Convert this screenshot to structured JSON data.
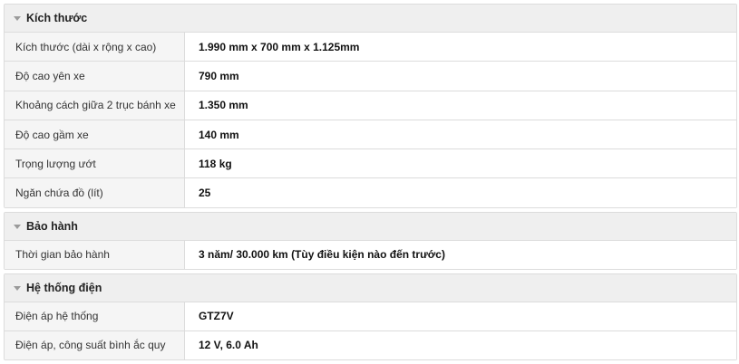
{
  "sections": [
    {
      "title": "Kích thước",
      "rows": [
        {
          "label": "Kích thước (dài x rộng x cao)",
          "value": "1.990 mm x 700 mm x 1.125mm"
        },
        {
          "label": "Độ cao yên xe",
          "value": "790 mm"
        },
        {
          "label": "Khoảng cách giữa 2 trục bánh xe",
          "value": "1.350 mm"
        },
        {
          "label": "Độ cao gầm xe",
          "value": "140 mm"
        },
        {
          "label": "Trọng lượng ướt",
          "value": "118 kg"
        },
        {
          "label": "Ngăn chứa đồ (lít)",
          "value": "25"
        }
      ]
    },
    {
      "title": "Bảo hành",
      "rows": [
        {
          "label": "Thời gian bảo hành",
          "value": "3 năm/ 30.000 km (Tùy điều kiện nào đến trước)"
        }
      ]
    },
    {
      "title": "Hệ thống điện",
      "rows": [
        {
          "label": "Điện áp hệ thống",
          "value": "GTZ7V"
        },
        {
          "label": "Điện áp, công suất bình ắc quy",
          "value": "12 V, 6.0 Ah"
        }
      ]
    }
  ]
}
